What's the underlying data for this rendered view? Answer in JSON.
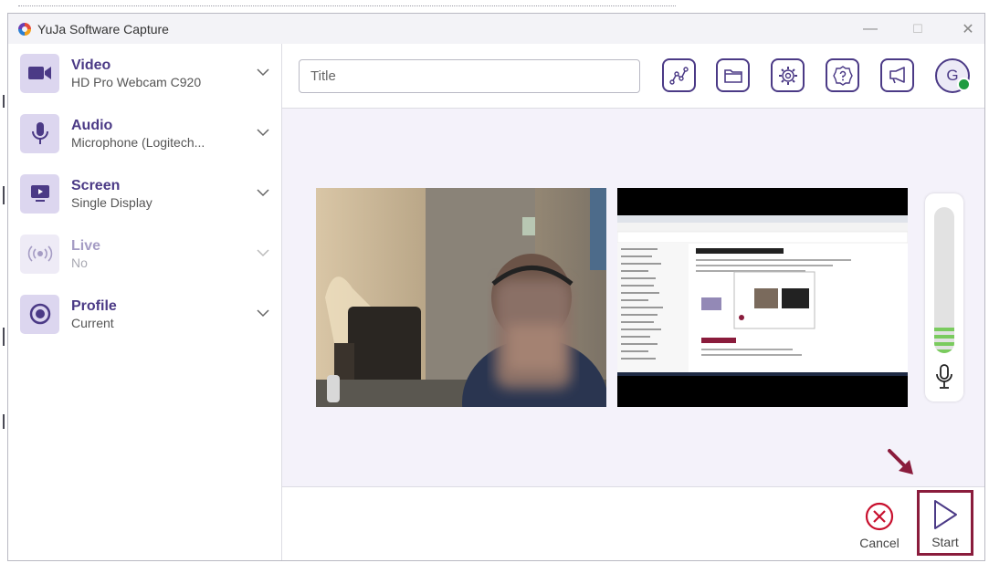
{
  "window": {
    "title": "YuJa Software Capture",
    "minimize_glyph": "—",
    "maximize_glyph": "☐",
    "close_glyph": "✕"
  },
  "sources": [
    {
      "title": "Video",
      "subtitle": "HD Pro Webcam C920",
      "icon": "video-camera-icon",
      "enabled": true
    },
    {
      "title": "Audio",
      "subtitle": "Microphone (Logitech...",
      "icon": "microphone-icon",
      "enabled": true
    },
    {
      "title": "Screen",
      "subtitle": "Single Display",
      "icon": "monitor-play-icon",
      "enabled": true
    },
    {
      "title": "Live",
      "subtitle": "No",
      "icon": "broadcast-icon",
      "enabled": false
    },
    {
      "title": "Profile",
      "subtitle": "Current",
      "icon": "profile-circle-icon",
      "enabled": true
    }
  ],
  "toolbar": {
    "title_placeholder": "Title",
    "buttons": [
      "analytics-icon",
      "folder-icon",
      "settings-icon",
      "help-icon",
      "announcement-icon"
    ],
    "avatar_initial": "G",
    "status_color": "#1e9b3f"
  },
  "preview": {
    "audio_level_bars_lit": 4
  },
  "actions": {
    "cancel_label": "Cancel",
    "start_label": "Start"
  },
  "colors": {
    "accent": "#4b3a86",
    "icon_bg": "#dcd6ef",
    "highlight": "#8a1c3c",
    "cancel_red": "#c8102e",
    "meter_green": "#7acb5e"
  }
}
